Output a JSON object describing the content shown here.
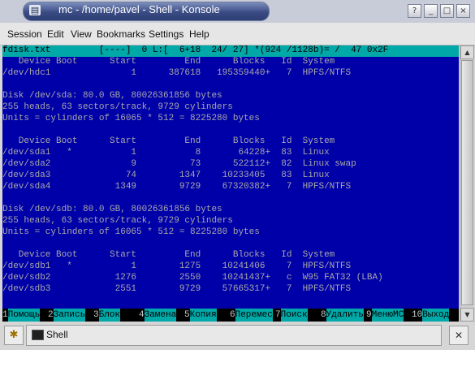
{
  "window": {
    "title": "mc - /home/pavel - Shell - Konsole",
    "buttons": {
      "help": "?",
      "minimize": "_",
      "maximize": "□",
      "close": "×"
    }
  },
  "menu": [
    "Session",
    "Edit",
    "View",
    "Bookmarks",
    "Settings",
    "Help"
  ],
  "terminal": {
    "lines": [
      "fdisk.txt         [----]  0 L:[  6+18  24/ 27] *(924 /1128b)= /  47 0x2F",
      "   Device Boot      Start         End      Blocks   Id  System",
      "/dev/hdc1               1      387618   195359440+   7  HPFS/NTFS",
      "",
      "Disk /dev/sda: 80.0 GB, 80026361856 bytes",
      "255 heads, 63 sectors/track, 9729 cylinders",
      "Units = cylinders of 16065 * 512 = 8225280 bytes",
      "",
      "   Device Boot      Start         End      Blocks   Id  System",
      "/dev/sda1   *           1           8       64228+  83  Linux",
      "/dev/sda2               9          73      522112+  82  Linux swap",
      "/dev/sda3              74        1347    10233405   83  Linux",
      "/dev/sda4            1349        9729    67320382+   7  HPFS/NTFS",
      "",
      "Disk /dev/sdb: 80.0 GB, 80026361856 bytes",
      "255 heads, 63 sectors/track, 9729 cylinders",
      "Units = cylinders of 16065 * 512 = 8225280 bytes",
      "",
      "   Device Boot      Start         End      Blocks   Id  System",
      "/dev/sdb1   *           1        1275    10241406    7  HPFS/NTFS",
      "/dev/sdb2            1276        2550    10241437+   c  W95 FAT32 (LBA)",
      "/dev/sdb3            2551        9729    57665317+   7  HPFS/NTFS",
      "",
      ""
    ]
  },
  "function_keys": [
    {
      "num": "1",
      "label": "Помощь"
    },
    {
      "num": "2",
      "label": "Запись"
    },
    {
      "num": "3",
      "label": "Блок"
    },
    {
      "num": "4",
      "label": "Замена"
    },
    {
      "num": "5",
      "label": "Копия"
    },
    {
      "num": "6",
      "label": "Перемес"
    },
    {
      "num": "7",
      "label": "Поиск"
    },
    {
      "num": "8",
      "label": "Удалить"
    },
    {
      "num": "9",
      "label": "МенюMC"
    },
    {
      "num": "10",
      "label": "Выход"
    }
  ],
  "tabs": {
    "new_tab_icon": "konsole-new-icon",
    "shell_label": "Shell",
    "close_icon": "close-icon"
  },
  "colors": {
    "terminal_bg": "#0000a8",
    "terminal_fg": "#a8a8a8",
    "header_bg": "#00a8a8"
  }
}
